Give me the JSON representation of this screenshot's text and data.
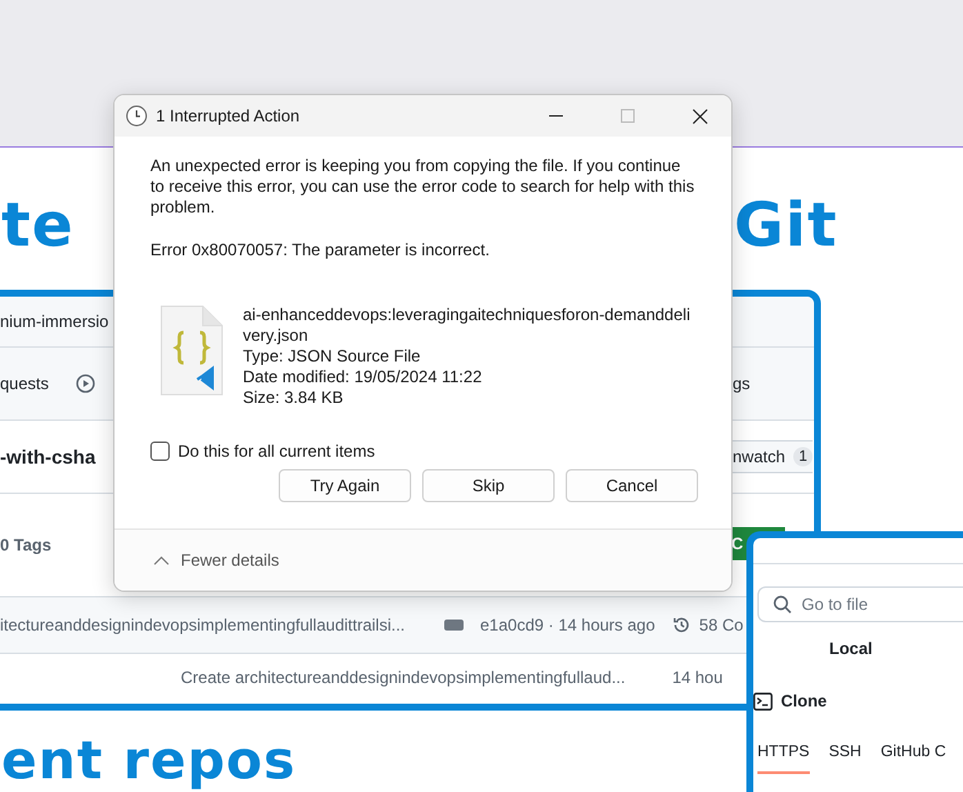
{
  "background": {
    "heading_fragments": [
      "te",
      "Git"
    ],
    "subheading": "ent repos"
  },
  "repo_screenshot": {
    "repo_name": "nium-immersio",
    "nav_tabs": [
      {
        "label": "quests",
        "kind": "text"
      },
      {
        "kind": "play"
      },
      {
        "label": "gs",
        "kind": "text"
      }
    ],
    "title": "-with-csha",
    "watch_button": {
      "label": "nwatch",
      "count": "1"
    },
    "tags": "0 Tags",
    "code_button": "C",
    "latest_commit": {
      "message": "itectureanddesignindevopsimplementingfullaudittrailsi...",
      "hash_time": "e1a0cd9 · 14 hours ago",
      "commits": "58 Co"
    },
    "file_rows": [
      {
        "message": "Create architectureanddesignindevopsimplementingfullaud...",
        "time": "14 hou"
      }
    ]
  },
  "clone_panel": {
    "search_placeholder": "Go to file",
    "tab": "Local",
    "clone_label": "Clone",
    "protocols": [
      {
        "label": "HTTPS",
        "selected": true
      },
      {
        "label": "SSH",
        "selected": false
      },
      {
        "label": "GitHub C",
        "selected": false
      }
    ]
  },
  "dialog": {
    "title": "1 Interrupted Action",
    "message": "An unexpected error is keeping you from copying the file. If you continue to receive this error, you can use the error code to search for help with this problem.",
    "error": "Error 0x80070057: The parameter is incorrect.",
    "file": {
      "name": "ai-enhanceddevops:leveragingaitechniquesforon-demanddelivery.json",
      "type": "Type: JSON Source File",
      "modified": "Date modified: 19/05/2024 11:22",
      "size": "Size: 3.84 KB"
    },
    "checkbox": {
      "label": "Do this for all current items",
      "checked": false
    },
    "buttons": [
      "Try Again",
      "Skip",
      "Cancel"
    ],
    "details_toggle": "Fewer details"
  }
}
